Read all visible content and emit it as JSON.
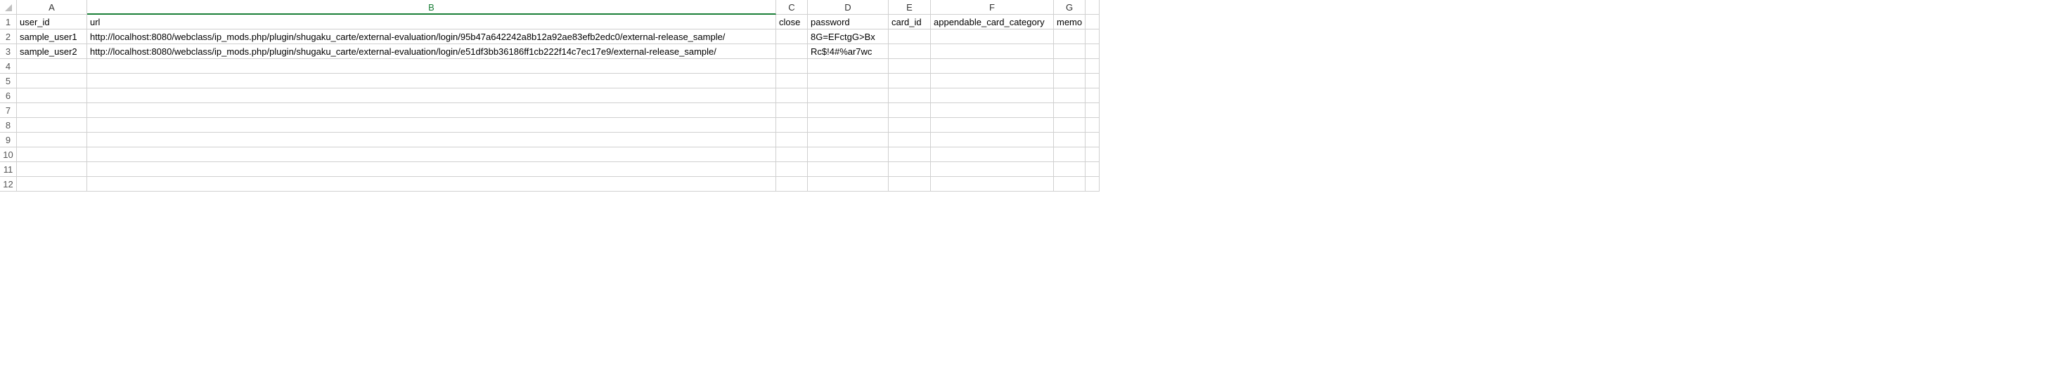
{
  "columns": [
    "A",
    "B",
    "C",
    "D",
    "E",
    "F",
    "G"
  ],
  "selected_column": "B",
  "row_numbers": [
    "1",
    "2",
    "3",
    "4",
    "5",
    "6",
    "7",
    "8",
    "9",
    "10",
    "11",
    "12"
  ],
  "headers": {
    "A": "user_id",
    "B": "url",
    "C": "close",
    "D": "password",
    "E": "card_id",
    "F": "appendable_card_category",
    "G": "memo"
  },
  "rows": [
    {
      "A": "sample_user1",
      "B": "http://localhost:8080/webclass/ip_mods.php/plugin/shugaku_carte/external-evaluation/login/95b47a642242a8b12a92ae83efb2edc0/external-release_sample/",
      "C": "",
      "D": "8G=EFctgG>Bx",
      "E": "",
      "F": "",
      "G": ""
    },
    {
      "A": "sample_user2",
      "B": "http://localhost:8080/webclass/ip_mods.php/plugin/shugaku_carte/external-evaluation/login/e51df3bb36186ff1cb222f14c7ec17e9/external-release_sample/",
      "C": "",
      "D": "Rc$!4#%ar7wc",
      "E": "",
      "F": "",
      "G": ""
    }
  ],
  "empty_rows_after": 9
}
